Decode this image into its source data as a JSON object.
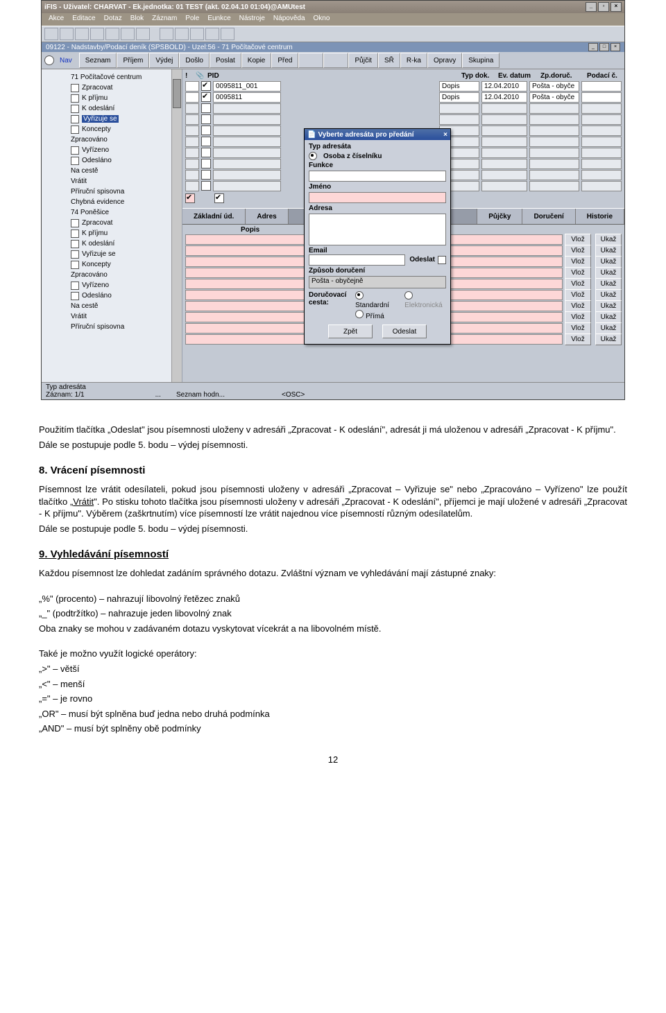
{
  "app": {
    "title": "iFIS - Uživatel: CHARVAT - Ek.jednotka: 01 TEST (akt. 02.04.10 01:04)@AMUtest",
    "menus": [
      "Akce",
      "Editace",
      "Dotaz",
      "Blok",
      "Záznam",
      "Pole",
      "Eunkce",
      "Nástroje",
      "Nápověda",
      "Okno"
    ],
    "subheader": "09122 - Nadstavby/Podací deník (SPSBOLD) - Uzel:56 - 71 Počítačové centrum",
    "nav_first": "Nav",
    "nav_tabs": [
      "Seznam",
      "Příjem",
      "Výdej",
      "Došlo",
      "Poslat",
      "Kopie",
      "Před",
      "",
      "",
      "Půjčit",
      "SŘ",
      "R-ka",
      "Opravy",
      "Skupina"
    ]
  },
  "tree": {
    "items": [
      {
        "level": 1,
        "cb": false,
        "label": "71 Počítačové centrum"
      },
      {
        "level": 2,
        "cb": true,
        "label": "Zpracovat"
      },
      {
        "level": 2,
        "cb": true,
        "label": "K příjmu"
      },
      {
        "level": 2,
        "cb": true,
        "label": "K odeslání"
      },
      {
        "level": 2,
        "cb": true,
        "label": "Vyřizuje se",
        "selected": true
      },
      {
        "level": 2,
        "cb": true,
        "label": "Koncepty"
      },
      {
        "level": 1,
        "cb": false,
        "label": "Zpracováno"
      },
      {
        "level": 2,
        "cb": true,
        "label": "Vyřízeno"
      },
      {
        "level": 2,
        "cb": true,
        "label": "Odesláno"
      },
      {
        "level": 1,
        "cb": false,
        "label": "Na cestě"
      },
      {
        "level": 1,
        "cb": false,
        "label": "Vrátit"
      },
      {
        "level": 1,
        "cb": false,
        "label": "Příruční spisovna"
      },
      {
        "level": 1,
        "cb": false,
        "label": "Chybná evidence"
      },
      {
        "level": 1,
        "cb": false,
        "label": "74 Poněšice"
      },
      {
        "level": 2,
        "cb": true,
        "label": "Zpracovat"
      },
      {
        "level": 2,
        "cb": true,
        "label": "K příjmu"
      },
      {
        "level": 2,
        "cb": true,
        "label": "K odeslání"
      },
      {
        "level": 2,
        "cb": true,
        "label": "Vyřizuje se"
      },
      {
        "level": 2,
        "cb": true,
        "label": "Koncepty"
      },
      {
        "level": 1,
        "cb": false,
        "label": "Zpracováno"
      },
      {
        "level": 2,
        "cb": true,
        "label": "Vyřízeno"
      },
      {
        "level": 2,
        "cb": true,
        "label": "Odesláno"
      },
      {
        "level": 1,
        "cb": false,
        "label": "Na cestě"
      },
      {
        "level": 1,
        "cb": false,
        "label": "Vrátit"
      },
      {
        "level": 1,
        "cb": false,
        "label": "Příruční spisovna"
      }
    ]
  },
  "cols": {
    "c1": "!",
    "c2": "",
    "c3": "PID",
    "c4": "Typ dok.",
    "c5": "Ev. datum",
    "c6": "Zp.doruč.",
    "c7": "Podací č."
  },
  "grid_rows": [
    {
      "pid": "0095811_001",
      "checked": true,
      "typ": "Dopis",
      "ev": "12.04.2010",
      "zp": "Pošta - obyče"
    },
    {
      "pid": "0095811",
      "checked": true,
      "typ": "Dopis",
      "ev": "12.04.2010",
      "zp": "Pošta - obyče"
    },
    {
      "pid": ""
    },
    {
      "pid": ""
    },
    {
      "pid": ""
    },
    {
      "pid": ""
    },
    {
      "pid": ""
    },
    {
      "pid": ""
    },
    {
      "pid": ""
    },
    {
      "pid": ""
    }
  ],
  "tabs2": [
    "Základní úd.",
    "Adres",
    "",
    "",
    "",
    "Půjčky",
    "Doručení",
    "Historie"
  ],
  "popis_label": "Popis",
  "dialog": {
    "title": "Vyberte adresáta pro předání",
    "typ_adresata": "Typ adresáta",
    "osoba_z_ciselniku": "Osoba z číselníku",
    "funkce": "Funkce",
    "jmeno": "Jméno",
    "adresa": "Adresa",
    "email": "Email",
    "odeslat_cb": "Odeslat",
    "zpusob_doruceni": "Způsob doručení",
    "zpusob_value": "Pošta - obyčejně",
    "dorucovaci": "Doručovací cesta:",
    "r_standardni": "Standardní",
    "r_elektronicka": "Elektronická",
    "r_prima": "Přímá",
    "btn_zpet": "Zpět",
    "btn_odeslat": "Odeslat"
  },
  "popis_buttons": {
    "vloz": "Vlož",
    "ukaz": "Ukaž"
  },
  "status": {
    "line1": "Typ adresáta",
    "rec": "Záznam: 1/1",
    "dots": "...",
    "sh": "Seznam hodn...",
    "osc": "<OSC>"
  },
  "doc": {
    "p1": "Použitím tlačítka „Odeslat\" jsou písemnosti uloženy v adresáři „Zpracovat - K odeslání\", adresát ji má uloženou v adresáři „Zpracovat - K příjmu\".",
    "p2": "Dále se postupuje podle 5. bodu – výdej písemnosti.",
    "h8": "8. Vrácení písemnosti",
    "p3": "Písemnost lze vrátit odesílateli, pokud jsou písemnosti uloženy v adresáři „Zpracovat – Vyřizuje se\" nebo „Zpracováno – Vyřízeno\" lze použít tlačítko „",
    "p3u": "Vrátit",
    "p3b": "\". Po stisku tohoto tlačítka jsou písemnosti uloženy v adresáři „Zpracovat - K odeslání\", příjemci je mají uložené v adresáři „Zpracovat - K příjmu\". Výběrem (zaškrtnutím) více písemností lze vrátit najednou více písemností různým odesílatelům.",
    "p4": "Dále se postupuje podle 5. bodu – výdej písemnosti.",
    "h9": "9. Vyhledávání písemností",
    "p5": "Každou písemnost lze dohledat zadáním správného dotazu. Zvláštní význam ve vyhledávání mají zástupné znaky:",
    "p6": "„%\" (procento) – nahrazují libovolný řetězec znaků",
    "p7": "„_\" (podtržítko) – nahrazuje jeden libovolný znak",
    "p8": "Oba znaky se mohou v zadávaném dotazu vyskytovat vícekrát a na libovolném místě.",
    "p9": "Také je možno využít logické operátory:",
    "p10": "„>\" – větší",
    "p11": "„<\" – menší",
    "p12": "„=\" – je rovno",
    "p13": "„OR\" – musí být splněna buď jedna nebo druhá podmínka",
    "p14": "„AND\" – musí být splněny obě podmínky",
    "pagenum": "12"
  }
}
